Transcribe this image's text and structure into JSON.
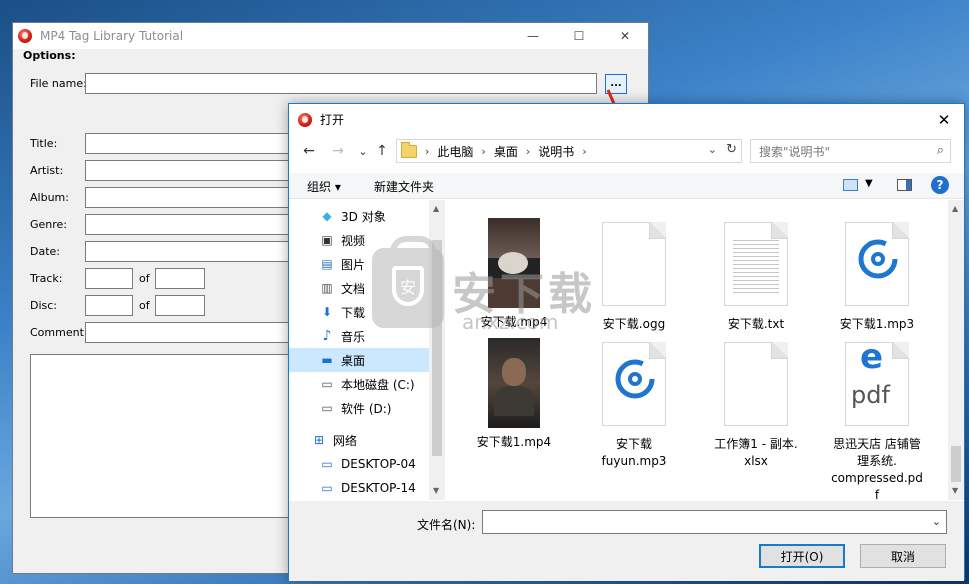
{
  "main_window": {
    "title": "MP4 Tag Library Tutorial",
    "controls": {
      "minimize": "—",
      "maximize": "☐",
      "close": "✕"
    },
    "options_label": "Options:",
    "labels": {
      "file_name": "File name:",
      "title": "Title:",
      "artist": "Artist:",
      "album": "Album:",
      "genre": "Genre:",
      "date": "Date:",
      "track": "Track:",
      "disc": "Disc:",
      "comment": "Comment:",
      "of1": "of",
      "of2": "of"
    },
    "browse_label": "..."
  },
  "dialog": {
    "title": "打开",
    "close": "✕",
    "nav": {
      "back": "←",
      "forward": "→",
      "recent": "⌄",
      "up": "↑"
    },
    "breadcrumbs": [
      "此电脑",
      "桌面",
      "说明书"
    ],
    "crumb_sep": "›",
    "search_placeholder": "搜索\"说明书\"",
    "toolbar": {
      "organize": "组织 ▾",
      "new_folder": "新建文件夹",
      "help": "?"
    },
    "nav_items": [
      {
        "label": "3D 对象",
        "icon": "3d-objects-icon",
        "glyph": "◆"
      },
      {
        "label": "视频",
        "icon": "video-icon",
        "glyph": "▣"
      },
      {
        "label": "图片",
        "icon": "pictures-icon",
        "glyph": "▤"
      },
      {
        "label": "文档",
        "icon": "documents-icon",
        "glyph": "▥"
      },
      {
        "label": "下载",
        "icon": "download-icon",
        "glyph": "⬇"
      },
      {
        "label": "音乐",
        "icon": "music-icon",
        "glyph": "♪"
      },
      {
        "label": "桌面",
        "icon": "desktop-icon",
        "glyph": "▬"
      },
      {
        "label": "本地磁盘 (C:)",
        "icon": "drive-c-icon",
        "glyph": "▭"
      },
      {
        "label": "软件 (D:)",
        "icon": "drive-d-icon",
        "glyph": "▭"
      },
      {
        "label": "网络",
        "icon": "network-icon",
        "glyph": "⊞"
      },
      {
        "label": "DESKTOP-04",
        "icon": "computer-icon",
        "glyph": "▭"
      },
      {
        "label": "DESKTOP-14",
        "icon": "computer-icon",
        "glyph": "▭"
      }
    ],
    "files": [
      {
        "name": "安下载.mp4",
        "kind": "video"
      },
      {
        "name": "安下载.ogg",
        "kind": "doc"
      },
      {
        "name": "安下载.txt",
        "kind": "text"
      },
      {
        "name": "安下载1.mp3",
        "kind": "music"
      },
      {
        "name": "安下载1.mp4",
        "kind": "video"
      },
      {
        "name": "安下载\nfuyun.mp3",
        "kind": "music"
      },
      {
        "name": "工作簿1 - 副本.\nxlsx",
        "kind": "doc"
      },
      {
        "name": "思迅天店 店铺管\n理系统.\ncompressed.pd\nf",
        "kind": "pdf"
      }
    ],
    "file_name_label": "文件名(N):",
    "file_name_value": "",
    "open_button": "打开(O)",
    "cancel_button": "取消"
  },
  "watermark": {
    "text": "安下载",
    "sub": "anxz.com",
    "shield": "安"
  },
  "colors": {
    "accent": "#1979ca",
    "arrow": "#e0261b",
    "selected_bg": "#cce8ff"
  }
}
